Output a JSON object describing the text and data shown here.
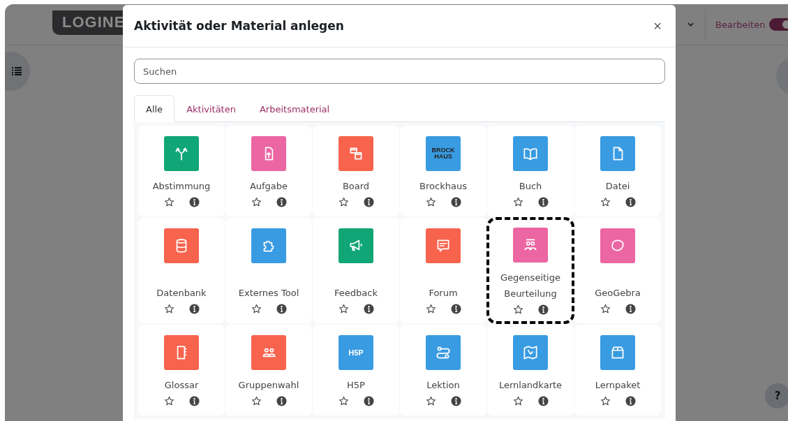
{
  "page": {
    "logo": "LOGINE",
    "edit_label": "Bearbeiten",
    "edit_mode": {
      "on": true
    },
    "help": "?"
  },
  "dialog": {
    "title": "Aktivität oder Material anlegen",
    "close": "×",
    "search": {
      "placeholder": "Suchen"
    },
    "tabs": [
      {
        "label": "Alle",
        "selected": true
      },
      {
        "label": "Aktivitäten",
        "selected": false
      },
      {
        "label": "Arbeitsmaterial",
        "selected": false
      }
    ],
    "items": [
      {
        "name": "Abstimmung",
        "color": "#11a676",
        "highlighted": false
      },
      {
        "name": "Aufgabe",
        "color": "#eb66a2",
        "highlighted": false
      },
      {
        "name": "Board",
        "color": "#f7634d",
        "highlighted": false
      },
      {
        "name": "Brockhaus",
        "color": "#399be2",
        "icon_text": "BROCK HAUS",
        "highlighted": false
      },
      {
        "name": "Buch",
        "color": "#399be2",
        "highlighted": false
      },
      {
        "name": "Datei",
        "color": "#399be2",
        "highlighted": false
      },
      {
        "name": "Datenbank",
        "color": "#f7634d",
        "highlighted": false
      },
      {
        "name": "Externes Tool",
        "color": "#399be2",
        "highlighted": false
      },
      {
        "name": "Feedback",
        "color": "#11a676",
        "highlighted": false
      },
      {
        "name": "Forum",
        "color": "#f7634d",
        "highlighted": false
      },
      {
        "name": "Gegenseitige Beurteilung",
        "color": "#eb66a2",
        "highlighted": true
      },
      {
        "name": "GeoGebra",
        "color": "#eb66a2",
        "highlighted": false
      },
      {
        "name": "Glossar",
        "color": "#f7634d",
        "highlighted": false
      },
      {
        "name": "Gruppenwahl",
        "color": "#f7634d",
        "highlighted": false
      },
      {
        "name": "H5P",
        "color": "#399be2",
        "icon_text": "H5P",
        "highlighted": false
      },
      {
        "name": "Lektion",
        "color": "#399be2",
        "highlighted": false
      },
      {
        "name": "Lernlandkarte",
        "color": "#399be2",
        "highlighted": false
      },
      {
        "name": "Lernpaket",
        "color": "#399be2",
        "highlighted": false
      }
    ]
  }
}
